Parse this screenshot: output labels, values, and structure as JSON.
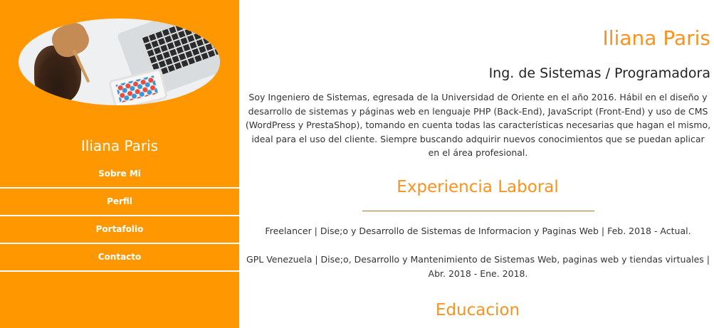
{
  "sidebar": {
    "name": "Iliana Paris",
    "nav": [
      {
        "label": "Sobre Mi"
      },
      {
        "label": "Perfil"
      },
      {
        "label": "Portafolio"
      },
      {
        "label": "Contacto"
      }
    ]
  },
  "main": {
    "name": "Iliana Paris",
    "role": "Ing. de Sistemas / Programadora",
    "about": "Soy Ingeniero de Sistemas, egresada de la Universidad de Oriente en el año 2016. Hábil en el diseño y desarrollo de sistemas y páginas web en lenguaje PHP (Back-End), JavaScript (Front-End) y uso de CMS (WordPress y PrestaShop), tomando en cuenta todas las características necesarias que hagan el mismo, ideal para el uso del cliente. Siempre buscando adquirir nuevos conocimientos que se puedan aplicar en el área profesional.",
    "experience_heading": "Experiencia Laboral",
    "jobs": [
      "Freelancer | Dise;o y Desarrollo de Sistemas de Informacion y Paginas Web | Feb. 2018 - Actual.",
      "GPL Venezuela | Dise;o, Desarrollo y Mantenimiento de Sistemas Web, paginas web y tiendas virtuales | Abr. 2018 - Ene. 2018."
    ],
    "education_heading": "Educacion"
  },
  "colors": {
    "sidebar_bg": "#ff9800",
    "accent": "#f7931e",
    "text": "#333333"
  }
}
